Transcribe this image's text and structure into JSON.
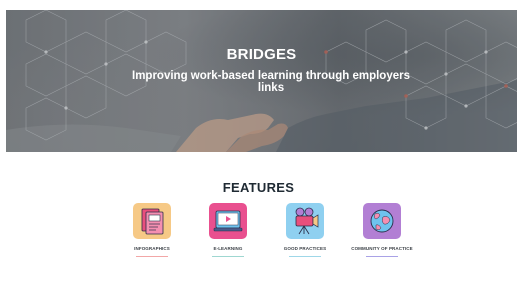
{
  "hero": {
    "title": "BRIDGES",
    "subtitle": "Improving work-based learning through employers links"
  },
  "features": {
    "title": "FEATURES",
    "items": [
      {
        "label": "INFOGRAPHICS",
        "icon": "infographics-icon",
        "tile_color": "#f6c986",
        "underline_color": "#f2a7a7"
      },
      {
        "label": "E-LEARNING",
        "icon": "video-player-icon",
        "tile_color": "#e9508f",
        "underline_color": "#9fd7d1"
      },
      {
        "label": "GOOD PRACTICES",
        "icon": "video-camera-icon",
        "tile_color": "#8fd0f0",
        "underline_color": "#9fd7e8"
      },
      {
        "label": "COMMUNITY OF PRACTICE",
        "icon": "globe-icon",
        "tile_color": "#b27fd4",
        "underline_color": "#a9a2e6"
      }
    ]
  }
}
